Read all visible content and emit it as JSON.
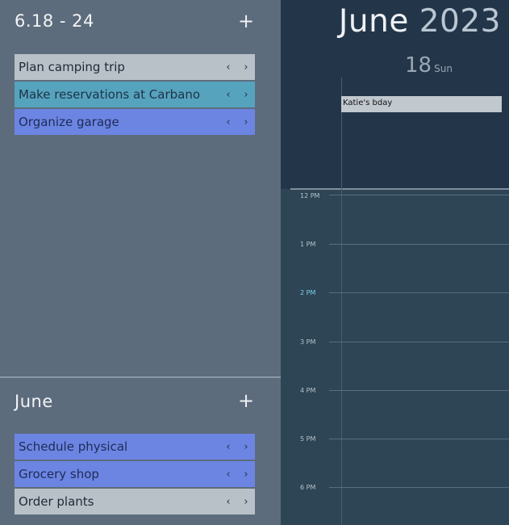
{
  "week_panel": {
    "title": "6.18 - 24",
    "add_label": "+",
    "tasks": [
      {
        "label": "Plan camping trip",
        "color": "#b9c1c8"
      },
      {
        "label": "Make reservations at Carbano",
        "color": "#56a3be"
      },
      {
        "label": "Organize garage",
        "color": "#6c85e3"
      }
    ]
  },
  "month_panel": {
    "title": "June",
    "add_label": "+",
    "tasks": [
      {
        "label": "Schedule physical",
        "color": "#6c85e3"
      },
      {
        "label": "Grocery shop",
        "color": "#6c85e3"
      },
      {
        "label": "Order plants",
        "color": "#b9c1c8"
      }
    ]
  },
  "arrows": {
    "prev": "‹",
    "next": "›"
  },
  "calendar": {
    "month": "June",
    "year": "2023",
    "day_number": "18",
    "day_name": "Sun",
    "all_day_event": "Katie's bday",
    "times": [
      "12 PM",
      "1 PM",
      "2 PM",
      "3 PM",
      "4 PM",
      "5 PM",
      "6 PM"
    ],
    "current_time_label": "2 PM"
  },
  "colors": {
    "left_panel_bg": "#5d6c7c",
    "calendar_bg": "#233549",
    "grid_bg": "#2d4555",
    "current_time": "#7fd0e6"
  }
}
